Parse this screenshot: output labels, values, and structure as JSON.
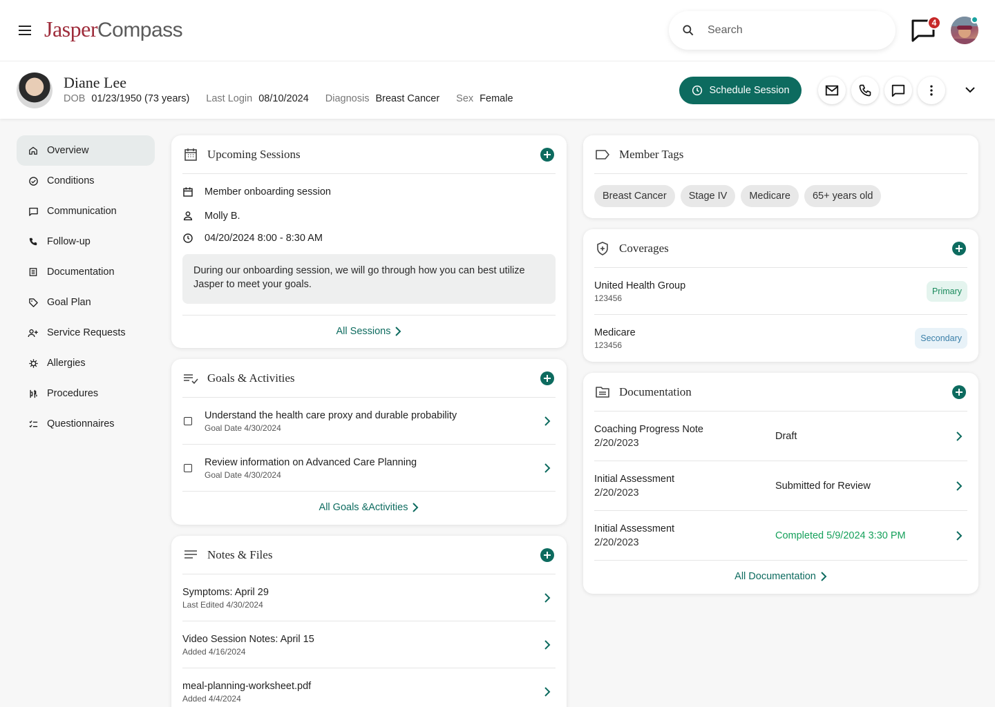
{
  "app": {
    "logo_part1": "Jasper",
    "logo_part2": "Compass",
    "search_placeholder": "Search",
    "message_count": "4"
  },
  "patient": {
    "name": "Diane Lee",
    "dob_label": "DOB",
    "dob_value": "01/23/1950 (73 years)",
    "last_login_label": "Last Login",
    "last_login_value": "08/10/2024",
    "diagnosis_label": "Diagnosis",
    "diagnosis_value": "Breast Cancer",
    "sex_label": "Sex",
    "sex_value": "Female",
    "schedule_label": "Schedule Session"
  },
  "sidebar": {
    "items": [
      {
        "label": "Overview",
        "icon": "home-icon"
      },
      {
        "label": "Conditions",
        "icon": "check-circle-icon"
      },
      {
        "label": "Communication",
        "icon": "chat-icon"
      },
      {
        "label": "Follow-up",
        "icon": "phone-icon"
      },
      {
        "label": "Documentation",
        "icon": "document-icon"
      },
      {
        "label": "Goal Plan",
        "icon": "tag-icon"
      },
      {
        "label": "Service Requests",
        "icon": "person-add-icon"
      },
      {
        "label": "Allergies",
        "icon": "allergy-icon"
      },
      {
        "label": "Procedures",
        "icon": "procedures-icon"
      },
      {
        "label": "Questionnaires",
        "icon": "checklist-icon"
      }
    ]
  },
  "upcoming": {
    "title": "Upcoming Sessions",
    "session_name": "Member onboarding session",
    "coach": "Molly B.",
    "time": "04/20/2024 8:00 - 8:30 AM",
    "description": "During our onboarding session, we will go through how you can best utilize Jasper to meet your goals.",
    "link": "All Sessions"
  },
  "goals": {
    "title": "Goals & Activities",
    "items": [
      {
        "title": "Understand the health care proxy and durable probability",
        "sub": "Goal Date 4/30/2024"
      },
      {
        "title": "Review information on Advanced Care Planning",
        "sub": "Goal Date 4/30/2024"
      }
    ],
    "link": "All Goals &Activities"
  },
  "notes": {
    "title": "Notes & Files",
    "items": [
      {
        "title": "Symptoms: April 29",
        "sub": "Last Edited 4/30/2024"
      },
      {
        "title": "Video Session Notes: April 15",
        "sub": "Added 4/16/2024"
      },
      {
        "title": "meal-planning-worksheet.pdf",
        "sub": "Added 4/4/2024"
      }
    ]
  },
  "tags": {
    "title": "Member Tags",
    "items": [
      "Breast Cancer",
      "Stage IV",
      "Medicare",
      "65+ years old"
    ]
  },
  "coverages": {
    "title": "Coverages",
    "items": [
      {
        "name": "United Health Group",
        "id": "123456",
        "badge": "Primary"
      },
      {
        "name": "Medicare",
        "id": "123456",
        "badge": "Secondary"
      }
    ]
  },
  "documentation": {
    "title": "Documentation",
    "items": [
      {
        "title": "Coaching Progress Note",
        "date": "2/20/2023",
        "status": "Draft"
      },
      {
        "title": "Initial Assessment",
        "date": "2/20/2023",
        "status": "Submitted for Review"
      },
      {
        "title": "Initial Assessment",
        "date": "2/20/2023",
        "status": "Completed 5/9/2024 3:30 PM"
      }
    ],
    "link": "All Documentation"
  },
  "colors": {
    "brand": "#0d6b5f",
    "logo_red": "#9e2b3a",
    "completed_green": "#14a05a",
    "badge_red": "#c62828"
  }
}
